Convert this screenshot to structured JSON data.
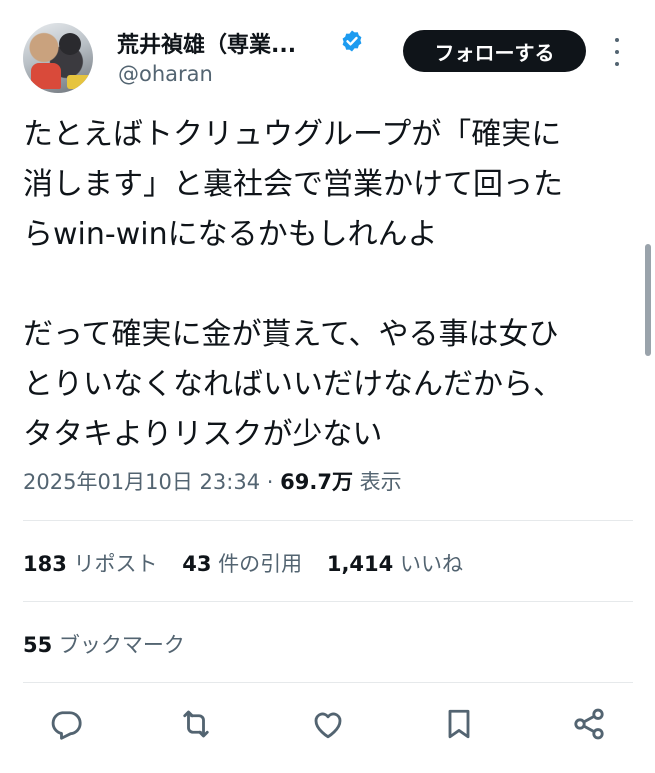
{
  "author": {
    "name": "荒井禎雄（専業...",
    "handle": "@oharan",
    "verified": true
  },
  "follow_label": "フォローする",
  "tweet": {
    "text": "たとえばトクリュウグループが「確実に\n消します」と裏社会で営業かけて回った\nらwin-winになるかもしれんよ\n\nだって確実に金が貰えて、やる事は女ひ\nとりいなくなればいいだけなんだから、\nタタキよりリスクが少ない",
    "timestamp": "2025年01月10日 23:34",
    "separator": " · ",
    "views": "69.7万",
    "views_label": "表示"
  },
  "stats": {
    "reposts_count": "183",
    "reposts_label": "リポスト",
    "quotes_count": "43",
    "quotes_label": "件の引用",
    "likes_count": "1,414",
    "likes_label": "いいね",
    "bookmarks_count": "55",
    "bookmarks_label": "ブックマーク"
  },
  "icons": [
    "reply-icon",
    "repost-icon",
    "like-icon",
    "bookmark-icon",
    "share-icon"
  ],
  "colors": {
    "text": "#0f1419",
    "secondary": "#536471",
    "verified": "#1d9bf0",
    "button_bg": "#0f1419",
    "divider": "#e6e9eb"
  }
}
